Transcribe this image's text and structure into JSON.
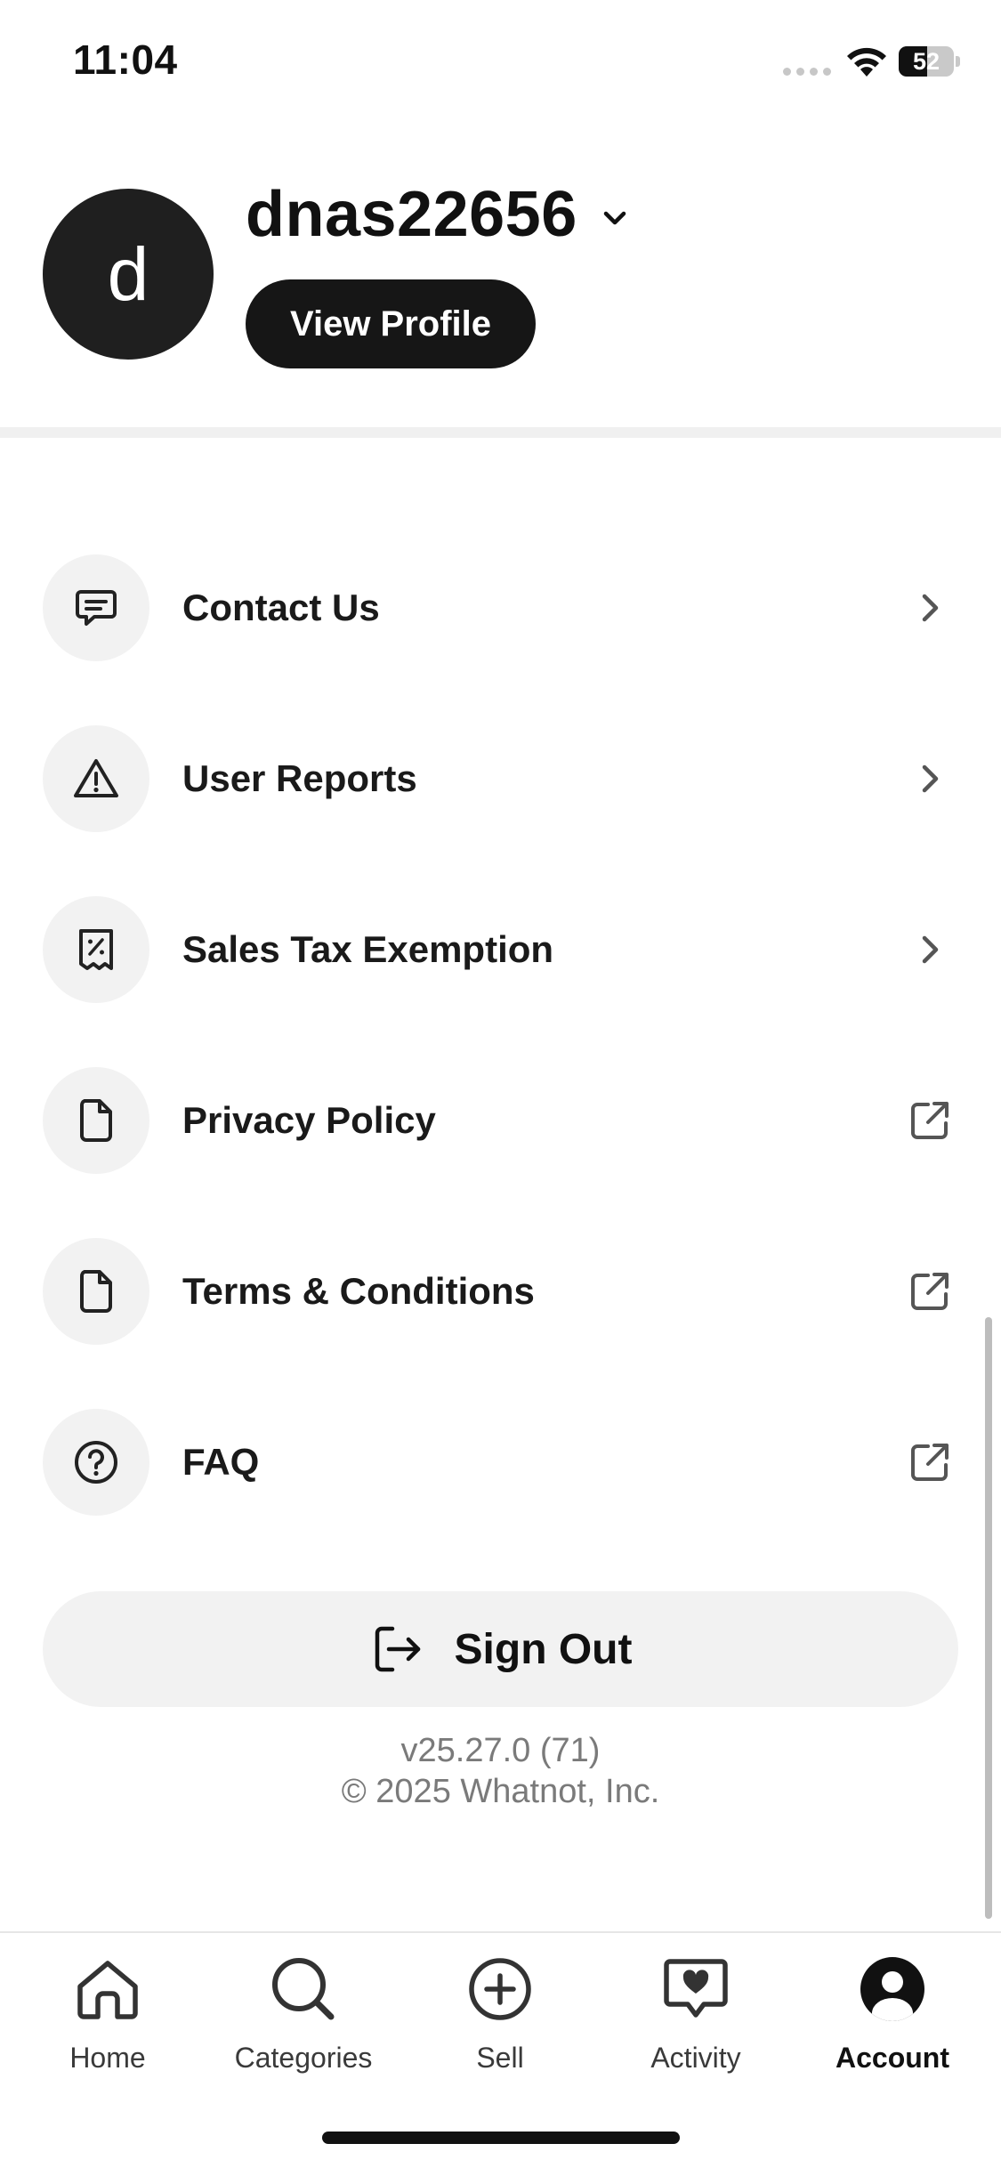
{
  "status_bar": {
    "time": "11:04",
    "battery_percent": "52",
    "battery_level": 0.52
  },
  "profile": {
    "avatar_letter": "d",
    "username": "dnas22656",
    "view_profile_label": "View Profile"
  },
  "menu": {
    "items": [
      {
        "label": "Contact Us",
        "icon": "chat-icon",
        "trailing": "chevron-right-icon"
      },
      {
        "label": "User Reports",
        "icon": "warning-icon",
        "trailing": "chevron-right-icon"
      },
      {
        "label": "Sales Tax Exemption",
        "icon": "receipt-percent-icon",
        "trailing": "chevron-right-icon"
      },
      {
        "label": "Privacy Policy",
        "icon": "document-icon",
        "trailing": "external-link-icon"
      },
      {
        "label": "Terms & Conditions",
        "icon": "document-icon",
        "trailing": "external-link-icon"
      },
      {
        "label": "FAQ",
        "icon": "question-circle-icon",
        "trailing": "external-link-icon"
      }
    ]
  },
  "sign_out": {
    "label": "Sign Out",
    "icon": "sign-out-icon"
  },
  "footer": {
    "version": "v25.27.0 (71)",
    "copyright": "© 2025 Whatnot, Inc."
  },
  "tabbar": {
    "tabs": [
      {
        "label": "Home",
        "icon": "home-icon",
        "active": false
      },
      {
        "label": "Categories",
        "icon": "search-icon",
        "active": false
      },
      {
        "label": "Sell",
        "icon": "plus-circle-icon",
        "active": false
      },
      {
        "label": "Activity",
        "icon": "heart-chat-icon",
        "active": false
      },
      {
        "label": "Account",
        "icon": "account-icon",
        "active": true
      }
    ]
  }
}
